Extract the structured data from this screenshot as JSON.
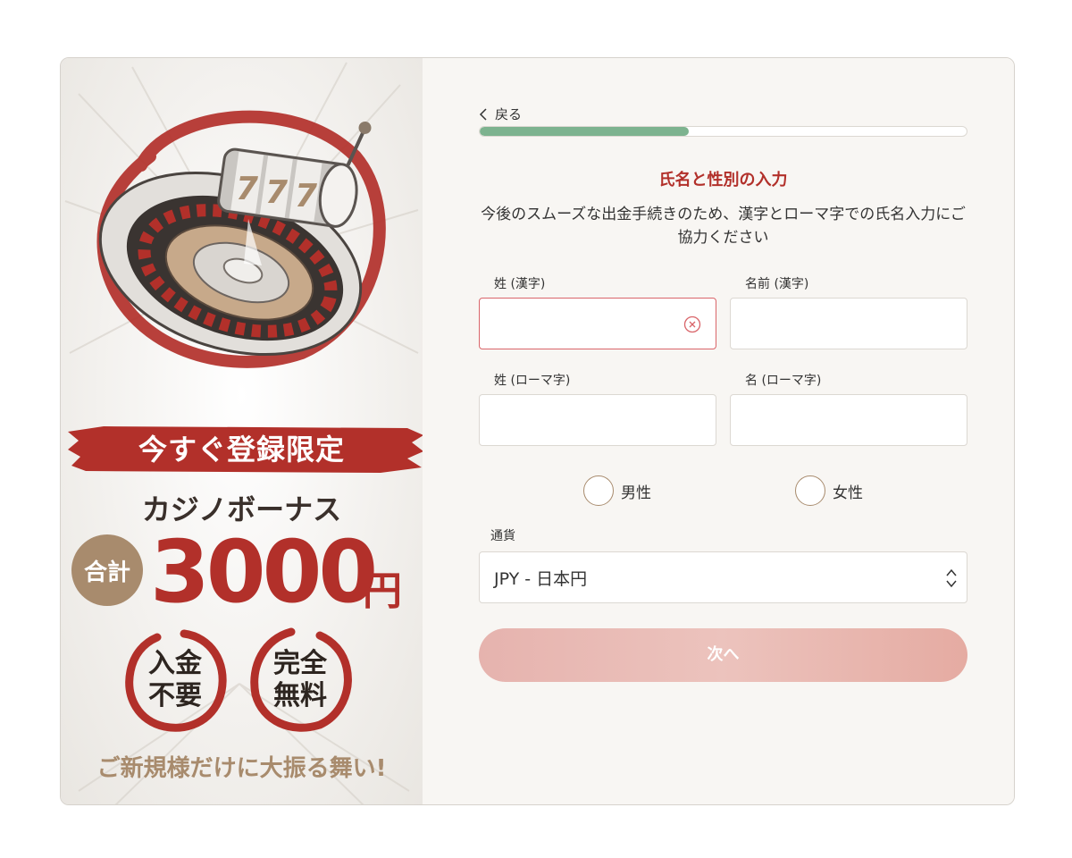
{
  "promo": {
    "banner": "今すぐ登録限定",
    "bonus_name": "カジノボーナス",
    "total_label": "合計",
    "amount": "3000",
    "amount_unit": "円",
    "stamp_no_deposit": "入金不要",
    "stamp_free": "完全無料",
    "tagline": "ご新規様だけに大振る舞い!",
    "slot_reel": [
      "7",
      "7",
      "7"
    ]
  },
  "form": {
    "back_label": "戻る",
    "progress": 0.43,
    "title": "氏名と性別の入力",
    "description": "今後のスムーズな出金手続きのため、漢字とローマ字での氏名入力にご協力ください",
    "fields": {
      "last_kanji_label": "姓 (漢字)",
      "first_kanji_label": "名前 (漢字)",
      "last_roman_label": "姓 (ローマ字)",
      "first_roman_label": "名 (ローマ字)"
    },
    "gender": {
      "male": "男性",
      "female": "女性"
    },
    "currency_label": "通貨",
    "currency_value": "JPY - 日本円",
    "next_label": "次へ"
  },
  "colors": {
    "accent_red": "#b2302a",
    "gold": "#a88b6d",
    "progress_green": "#7db38f",
    "error_border": "#d9656a"
  }
}
